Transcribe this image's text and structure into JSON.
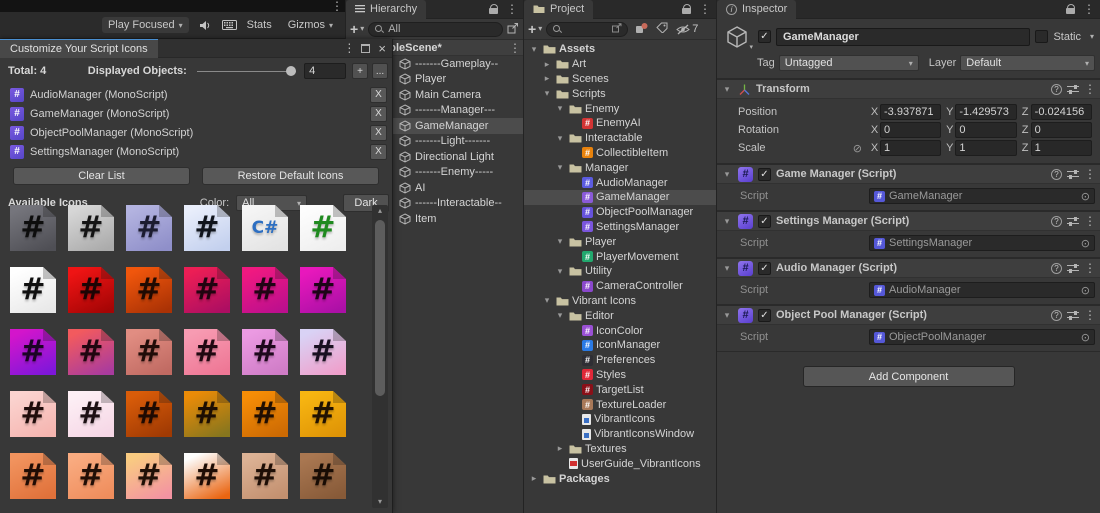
{
  "game_toolbar": {
    "play_focused": "Play Focused",
    "stats": "Stats",
    "gizmos": "Gizmos"
  },
  "icon_window": {
    "title": "Customize Your Script Icons",
    "total": "Total: 4",
    "displayed_label": "Displayed Objects:",
    "displayed_value": "4",
    "plus": "+",
    "more": "...",
    "remove_label": "X",
    "scripts": [
      "AudioManager (MonoScript)",
      "GameManager (MonoScript)",
      "ObjectPoolManager (MonoScript)",
      "SettingsManager (MonoScript)"
    ],
    "clear_button": "Clear List",
    "restore_button": "Restore Default Icons",
    "available_label": "Available Icons",
    "color_label": "Color:",
    "color_value": "All",
    "theme_button": "Dark",
    "grid": [
      {
        "glyph": "#",
        "bg": "#75757c",
        "bg2": "#4f4f55",
        "fg": "#0d0d0d"
      },
      {
        "glyph": "#",
        "bg": "#d6d6d6",
        "bg2": "#ababab",
        "fg": "#141414"
      },
      {
        "glyph": "#",
        "bg": "#b3b3e0",
        "bg2": "#8f8fc9",
        "fg": "#1c1c30"
      },
      {
        "glyph": "#",
        "bg": "#e9eefb",
        "bg2": "#c3d0ee",
        "fg": "#10141c"
      },
      {
        "glyph": "C#",
        "bg": "#f5f5f5",
        "bg2": "#e3e3e3",
        "fg": "#2d6fc2"
      },
      {
        "glyph": "#",
        "bg": "#fdfdfd",
        "bg2": "#eeeeee",
        "fg": "#1f8a1f"
      },
      {
        "glyph": "#",
        "bg": "#ffffff",
        "bg2": "#e8e8e8",
        "fg": "#101010"
      },
      {
        "glyph": "#",
        "bg": "#ef1414",
        "bg2": "#a50505",
        "fg": "#1c0404"
      },
      {
        "glyph": "#",
        "bg": "#f0560c",
        "bg2": "#aa3205",
        "fg": "#200a02"
      },
      {
        "glyph": "#",
        "bg": "#ec1e55",
        "bg2": "#ad0e62",
        "fg": "#200410"
      },
      {
        "glyph": "#",
        "bg": "#f01980",
        "bg2": "#bc0f8e",
        "fg": "#200414"
      },
      {
        "glyph": "#",
        "bg": "#e818bc",
        "bg2": "#ab10a6",
        "fg": "#1e0418"
      },
      {
        "glyph": "#",
        "bg": "#d315cb",
        "bg2": "#7e17da",
        "fg": "#1c0424"
      },
      {
        "glyph": "#",
        "bg": "#f25a5e",
        "bg2": "#a93b9e",
        "fg": "#200610"
      },
      {
        "glyph": "#",
        "bg": "#e18d82",
        "bg2": "#c06a62",
        "fg": "#200c08"
      },
      {
        "glyph": "#",
        "bg": "#f79bb2",
        "bg2": "#ee7795",
        "fg": "#200810"
      },
      {
        "glyph": "#",
        "bg": "#eb9ae2",
        "bg2": "#cf7cc6",
        "fg": "#1e081c"
      },
      {
        "glyph": "#",
        "bg": "#d9d2f5",
        "bg2": "#ef9fcb",
        "fg": "#181020"
      },
      {
        "glyph": "#",
        "bg": "#fbd3cf",
        "bg2": "#f5b5b0",
        "fg": "#200c0a"
      },
      {
        "glyph": "#",
        "bg": "#fdeff5",
        "bg2": "#f6d7e6",
        "fg": "#1c1014"
      },
      {
        "glyph": "#",
        "bg": "#d95c09",
        "bg2": "#a03a03",
        "fg": "#1e0a02"
      },
      {
        "glyph": "#",
        "bg": "#ea8b07",
        "bg2": "#87761e",
        "fg": "#1c0e02"
      },
      {
        "glyph": "#",
        "bg": "#f68d06",
        "bg2": "#cc6a03",
        "fg": "#200e02"
      },
      {
        "glyph": "#",
        "bg": "#f7b511",
        "bg2": "#df9406",
        "fg": "#201202"
      },
      {
        "glyph": "#",
        "bg": "#f1935e",
        "bg2": "#e0713a",
        "fg": "#200c04"
      },
      {
        "glyph": "#",
        "bg": "#f9ab80",
        "bg2": "#ef8d5c",
        "fg": "#200e06"
      },
      {
        "glyph": "#",
        "bg": "#f9cb81",
        "bg2": "#f393a2",
        "fg": "#201006"
      },
      {
        "glyph": "#",
        "bg": "#fdfdfc",
        "bg2": "#ea6511",
        "fg": "#1e0c04"
      },
      {
        "glyph": "#",
        "bg": "#dcb295",
        "bg2": "#c3906f",
        "fg": "#1e0e06"
      },
      {
        "glyph": "#",
        "bg": "#a97751",
        "bg2": "#875a38",
        "fg": "#180c04"
      }
    ]
  },
  "hierarchy": {
    "tab": "Hierarchy",
    "search_value": "All",
    "scene": "SampleScene*",
    "items": [
      {
        "label": "-------Gameplay--"
      },
      {
        "label": "Player"
      },
      {
        "label": "Main Camera"
      },
      {
        "label": "-------Manager---"
      },
      {
        "label": "GameManager",
        "selected": true
      },
      {
        "label": "-------Light-------"
      },
      {
        "label": "Directional Light"
      },
      {
        "label": "-------Enemy-----"
      },
      {
        "label": "AI"
      },
      {
        "label": "------Interactable--"
      },
      {
        "label": "Item"
      }
    ]
  },
  "project": {
    "tab": "Project",
    "search_value": "",
    "hidden_count": "7",
    "tree": [
      {
        "level": 0,
        "arrow": "open",
        "icon": "folder",
        "label": "Assets",
        "bold": true
      },
      {
        "level": 1,
        "arrow": "closed",
        "icon": "folder",
        "label": "Art"
      },
      {
        "level": 1,
        "arrow": "closed",
        "icon": "folder",
        "label": "Scenes"
      },
      {
        "level": 1,
        "arrow": "open",
        "icon": "folder",
        "label": "Scripts"
      },
      {
        "level": 2,
        "arrow": "open",
        "icon": "folder",
        "label": "Enemy"
      },
      {
        "level": 3,
        "icon": "script",
        "color": "#d23434",
        "label": "EnemyAI"
      },
      {
        "level": 2,
        "arrow": "open",
        "icon": "folder",
        "label": "Interactable"
      },
      {
        "level": 3,
        "icon": "script",
        "color": "#e8820c",
        "label": "CollectibleItem"
      },
      {
        "level": 2,
        "arrow": "open",
        "icon": "folder",
        "label": "Manager"
      },
      {
        "level": 3,
        "icon": "script",
        "color": "#5b5be0",
        "label": "AudioManager"
      },
      {
        "level": 3,
        "icon": "script",
        "color": "#8a5ad8",
        "label": "GameManager",
        "selected": true
      },
      {
        "level": 3,
        "icon": "script",
        "color": "#6652dc",
        "label": "ObjectPoolManager"
      },
      {
        "level": 3,
        "icon": "script",
        "color": "#7a55dc",
        "label": "SettingsManager"
      },
      {
        "level": 2,
        "arrow": "open",
        "icon": "folder",
        "label": "Player"
      },
      {
        "level": 3,
        "icon": "script",
        "color": "#22a86e",
        "label": "PlayerMovement"
      },
      {
        "level": 2,
        "arrow": "open",
        "icon": "folder",
        "label": "Utility"
      },
      {
        "level": 3,
        "icon": "script",
        "color": "#8a48cc",
        "label": "CameraController"
      },
      {
        "level": 1,
        "arrow": "open",
        "icon": "folder",
        "label": "Vibrant Icons"
      },
      {
        "level": 2,
        "arrow": "open",
        "icon": "folder",
        "label": "Editor"
      },
      {
        "level": 3,
        "icon": "script",
        "color": "#9a50d4",
        "label": "IconColor"
      },
      {
        "level": 3,
        "icon": "script",
        "color": "#2a7ae4",
        "label": "IconManager"
      },
      {
        "level": 3,
        "icon": "script",
        "color": "#2e2e34",
        "label": "Preferences"
      },
      {
        "level": 3,
        "icon": "script",
        "color": "#e02838",
        "label": "Styles"
      },
      {
        "level": 3,
        "icon": "script",
        "color": "#8a1018",
        "label": "TargetList"
      },
      {
        "level": 3,
        "icon": "script",
        "color": "#a87858",
        "label": "TextureLoader"
      },
      {
        "level": 3,
        "icon": "doc",
        "label": "VibrantIcons"
      },
      {
        "level": 3,
        "icon": "doc",
        "label": "VibrantIconsWindow"
      },
      {
        "level": 2,
        "arrow": "closed",
        "icon": "folder",
        "label": "Textures"
      },
      {
        "level": 2,
        "icon": "pdf",
        "label": "UserGuide_VibrantIcons"
      },
      {
        "level": 0,
        "arrow": "closed",
        "icon": "folder",
        "label": "Packages",
        "bold": true
      }
    ]
  },
  "inspector": {
    "tab": "Inspector",
    "name": "GameManager",
    "static_label": "Static",
    "tag_label": "Tag",
    "tag_value": "Untagged",
    "layer_label": "Layer",
    "layer_value": "Default",
    "transform": {
      "title": "Transform",
      "rows": [
        {
          "label": "Position",
          "x": "-3.937871",
          "y": "-1.429573",
          "z": "-0.024156"
        },
        {
          "label": "Rotation",
          "x": "0",
          "y": "0",
          "z": "0"
        },
        {
          "label": "Scale",
          "x": "1",
          "y": "1",
          "z": "1",
          "link": true
        }
      ]
    },
    "components": [
      {
        "title": "Game Manager (Script)",
        "field": "Script",
        "value": "GameManager"
      },
      {
        "title": "Settings Manager (Script)",
        "field": "Script",
        "value": "SettingsManager"
      },
      {
        "title": "Audio Manager (Script)",
        "field": "Script",
        "value": "AudioManager"
      },
      {
        "title": "Object Pool Manager (Script)",
        "field": "Script",
        "value": "ObjectPoolManager"
      }
    ],
    "add_component": "Add Component"
  }
}
